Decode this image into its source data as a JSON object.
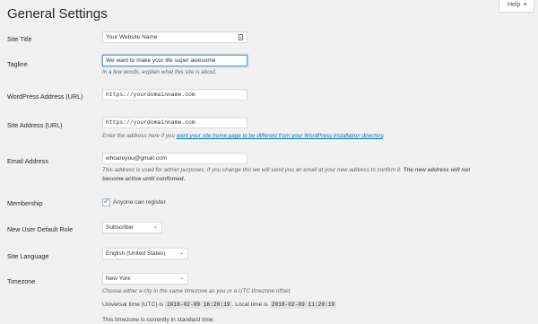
{
  "page": {
    "title": "General Settings",
    "help_label": "Help"
  },
  "labels": {
    "site_title": "Site Title",
    "tagline": "Tagline",
    "wp_address": "WordPress Address (URL)",
    "site_address": "Site Address (URL)",
    "email": "Email Address",
    "membership": "Membership",
    "default_role": "New User Default Role",
    "language": "Site Language",
    "timezone": "Timezone"
  },
  "values": {
    "site_title": "Your Website Name",
    "tagline": "We want to make your life super awesome",
    "wp_address": "https://yourdomainname.com",
    "site_address": "https://yourdomainname.com",
    "email": "whoareyou@gmail.com",
    "membership_checkbox_label": "Anyone can register",
    "membership_checked": true,
    "default_role": "Subscriber",
    "language": "English (United States)",
    "timezone": "New York"
  },
  "descriptions": {
    "tagline": "In a few words, explain what this site is about.",
    "site_address_before": "Enter the address here if you ",
    "site_address_link": "want your site home page to be different from your WordPress installation directory",
    "site_address_after": ".",
    "email_line1": "This address is used for admin purposes. If you change this we will send you an email at your new address to confirm it. ",
    "email_line1_bold": "The new address will not",
    "email_line2_bold": "become active until confirmed.",
    "timezone": "Choose either a city in the same timezone as you or a UTC timezone offset.",
    "universal_label": "Universal time (UTC) is",
    "universal_time": "2018-02-09 16:20:19",
    "local_label": ". Local time is",
    "local_time": "2018-02-09 11:20:19",
    "dst_note": "This timezone is currently in standard time."
  },
  "icons": {
    "help_caret": "caret-down-icon",
    "site_title_icon": "contact-card-icon",
    "select_chevron": "chevron-down-icon",
    "checkmark": "checkmark-icon"
  },
  "colors": {
    "accent": "#0073aa",
    "focus": "#5b9dd9",
    "check": "#1e8cbe",
    "background": "#f1f1f1"
  }
}
